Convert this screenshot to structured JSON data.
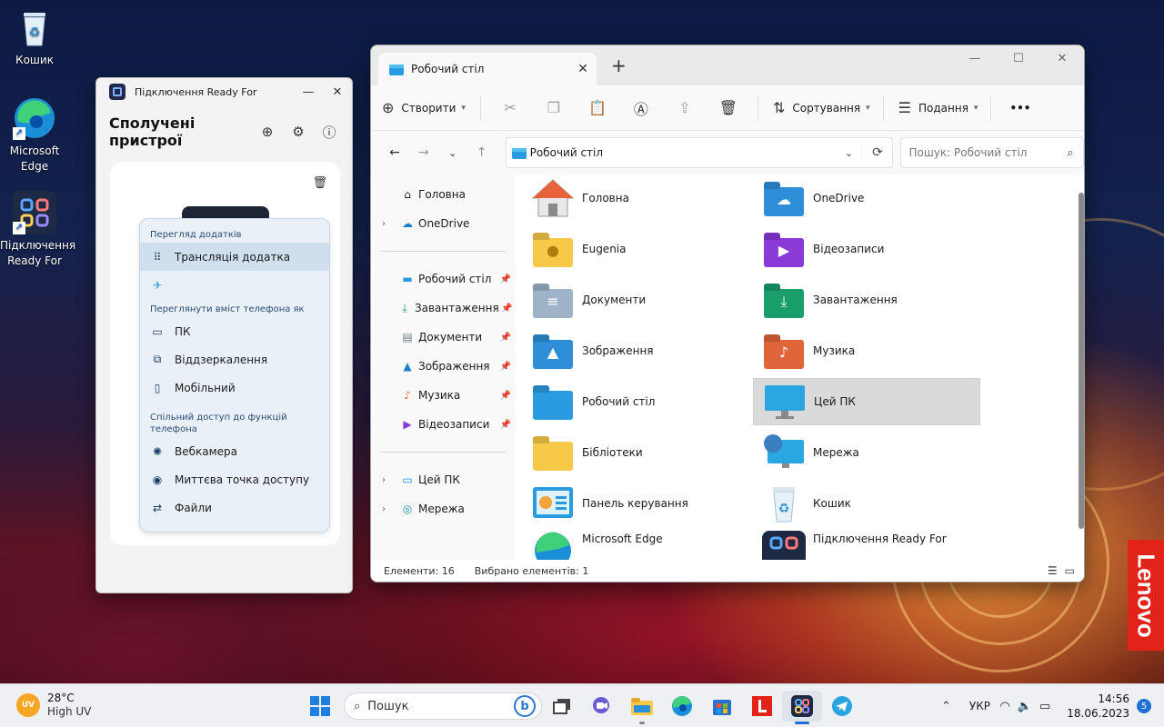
{
  "desktop": {
    "icons": [
      {
        "label": "Кошик"
      },
      {
        "label": "Microsoft Edge"
      },
      {
        "label": "Підключення Ready For"
      }
    ],
    "brand_badge": "Lenovo"
  },
  "ready_for": {
    "window_title": "Підключення Ready For",
    "heading": "Сполучені пристрої",
    "sections": [
      {
        "title": "Перегляд додатків",
        "items": [
          {
            "label": "Трансляція додатка"
          }
        ]
      },
      {
        "title": "Переглянути вміст телефона як",
        "items": [
          {
            "label": "ПК"
          },
          {
            "label": "Віддзеркалення"
          },
          {
            "label": "Мобільний"
          }
        ]
      },
      {
        "title": "Спільний доступ до функцій телефона",
        "items": [
          {
            "label": "Вебкамера"
          },
          {
            "label": "Миттєва точка доступу"
          },
          {
            "label": "Файли"
          }
        ]
      }
    ]
  },
  "explorer": {
    "tab_title": "Робочий стіл",
    "toolbar": {
      "create": "Створити",
      "sort": "Сортування",
      "view": "Подання",
      "more": "•••"
    },
    "address": "Робочий стіл",
    "search_placeholder": "Пошук: Робочий стіл",
    "nav": {
      "top": [
        {
          "label": "Головна"
        },
        {
          "label": "OneDrive"
        }
      ],
      "quick": [
        {
          "label": "Робочий стіл"
        },
        {
          "label": "Завантаження"
        },
        {
          "label": "Документи"
        },
        {
          "label": "Зображення"
        },
        {
          "label": "Музика"
        },
        {
          "label": "Відеозаписи"
        }
      ],
      "bottom": [
        {
          "label": "Цей ПК"
        },
        {
          "label": "Мережа"
        }
      ]
    },
    "items": [
      {
        "label": "Головна"
      },
      {
        "label": "OneDrive"
      },
      {
        "label": "Eugenia"
      },
      {
        "label": "Відеозаписи"
      },
      {
        "label": "Документи"
      },
      {
        "label": "Завантаження"
      },
      {
        "label": "Зображення"
      },
      {
        "label": "Музика"
      },
      {
        "label": "Робочий стіл"
      },
      {
        "label": "Цей ПК"
      },
      {
        "label": "Бібліотеки"
      },
      {
        "label": "Мережа"
      },
      {
        "label": "Панель керування"
      },
      {
        "label": "Кошик"
      },
      {
        "label": "Microsoft Edge"
      },
      {
        "label": "Підключення Ready For"
      }
    ],
    "status": {
      "count": "Елементи: 16",
      "selected": "Вибрано елементів: 1"
    }
  },
  "taskbar": {
    "weather_temp": "28°C",
    "weather_desc": "High UV",
    "weather_badge": "UV",
    "search_label": "Пошук",
    "bing_glyph": "b",
    "language": "УКР",
    "time": "14:56",
    "date": "18.06.2023",
    "notifications": "5"
  },
  "colors": {
    "accent": "#1f6fd6",
    "folder_yellow": "#f7c948",
    "folder_blue": "#2e8fd8",
    "lenovo_red": "#e2231a"
  }
}
